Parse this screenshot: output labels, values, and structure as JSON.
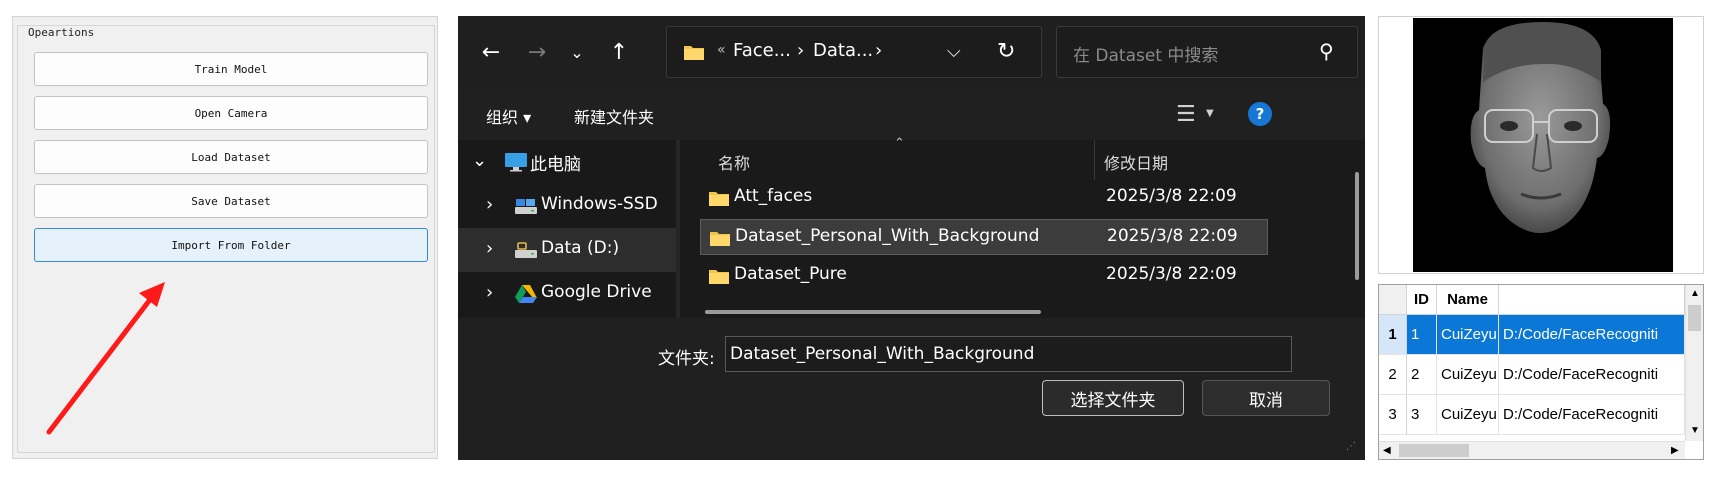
{
  "operations": {
    "group_title": "Opeartions",
    "buttons": [
      {
        "label": "Train Model"
      },
      {
        "label": "Open Camera"
      },
      {
        "label": "Load Dataset"
      },
      {
        "label": "Save Dataset"
      },
      {
        "label": "Import From Folder"
      }
    ],
    "highlight_arrow_color": "#ff1a1a"
  },
  "dialog": {
    "address": {
      "overflow_marker": "«",
      "crumbs": [
        "Face...",
        "Data..."
      ],
      "separator": "›"
    },
    "search_placeholder": "在 Dataset 中搜索",
    "commands": {
      "organize": "组织 ▾",
      "new_folder": "新建文件夹"
    },
    "nav_tree": [
      {
        "label": "此电脑",
        "expanded": true,
        "icon": "computer-icon"
      },
      {
        "label": "Windows-SSD",
        "expanded": false,
        "icon": "drive-icon"
      },
      {
        "label": "Data (D:)",
        "expanded": false,
        "icon": "drive-icon",
        "selected": true
      },
      {
        "label": "Google Drive",
        "expanded": false,
        "icon": "google-drive-icon"
      }
    ],
    "columns": {
      "name": "名称",
      "date": "修改日期"
    },
    "files": [
      {
        "name": "Att_faces",
        "date": "2025/3/8 22:09"
      },
      {
        "name": "Dataset_Personal_With_Background",
        "date": "2025/3/8 22:09",
        "selected": true
      },
      {
        "name": "Dataset_Pure",
        "date": "2025/3/8 22:09"
      }
    ],
    "folder_label": "文件夹:",
    "folder_value": "Dataset_Personal_With_Background",
    "select_button": "选择文件夹",
    "cancel_button": "取消",
    "accent_color": "#1677d4"
  },
  "table": {
    "headers": [
      "ID",
      "Name",
      ""
    ],
    "rows": [
      {
        "row": "1",
        "id": "1",
        "name": "CuiZeyu",
        "path": "D:/Code/FaceRecogniti",
        "selected": true
      },
      {
        "row": "2",
        "id": "2",
        "name": "CuiZeyu",
        "path": "D:/Code/FaceRecogniti"
      },
      {
        "row": "3",
        "id": "3",
        "name": "CuiZeyu",
        "path": "D:/Code/FaceRecogniti"
      }
    ],
    "selection_color": "#0b78d7"
  }
}
